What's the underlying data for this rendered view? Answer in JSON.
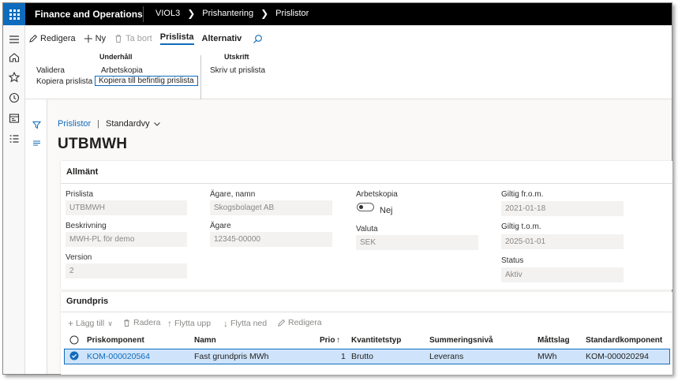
{
  "topbar": {
    "app_title": "Finance and Operations",
    "breadcrumbs": [
      "VIOL3",
      "Prishantering",
      "Prislistor"
    ]
  },
  "actionpane": {
    "edit_label": "Redigera",
    "new_label": "Ny",
    "delete_label": "Ta bort",
    "tab_active": "Prislista",
    "tab_other": "Alternativ",
    "groups": {
      "maintenance_title": "Underhåll",
      "validate": "Validera",
      "copy_pricelist": "Kopiera prislista",
      "work_copy": "Arbetskopia",
      "copy_to_existing": "Kopiera till befintlig prislista",
      "print_title": "Utskrift",
      "print_pricelist": "Skriv ut prislista"
    }
  },
  "page": {
    "breadcrumb_link": "Prislistor",
    "view_name": "Standardvy",
    "title": "UTBMWH"
  },
  "general": {
    "header": "Allmänt",
    "fields": {
      "prislista_label": "Prislista",
      "prislista_value": "UTBMWH",
      "beskrivning_label": "Beskrivning",
      "beskrivning_value": "MWH-PL för demo",
      "version_label": "Version",
      "version_value": "2",
      "agare_namn_label": "Ägare, namn",
      "agare_namn_value": "Skogsbolaget AB",
      "agare_label": "Ägare",
      "agare_value": "12345-00000",
      "arbetskopia_label": "Arbetskopia",
      "arbetskopia_value": "Nej",
      "valuta_label": "Valuta",
      "valuta_value": "SEK",
      "giltig_from_label": "Giltig fr.o.m.",
      "giltig_from_value": "2021-01-18",
      "giltig_tom_label": "Giltig t.o.m.",
      "giltig_tom_value": "2025-01-01",
      "status_label": "Status",
      "status_value": "Aktiv"
    }
  },
  "grid": {
    "header": "Grundpris",
    "toolbar": {
      "add": "Lägg till",
      "delete": "Radera",
      "move_up": "Flytta upp",
      "move_down": "Flytta ned",
      "edit": "Redigera"
    },
    "columns": {
      "prisk": "Priskomponent",
      "namn": "Namn",
      "prio": "Prio",
      "kvant": "Kvantitetstyp",
      "summ": "Summeringsnivå",
      "matt": "Måttslag",
      "std": "Standardkomponent"
    },
    "rows": [
      {
        "prisk": "KOM-000020564",
        "namn": "Fast grundpris MWh",
        "prio": "1",
        "kvant": "Brutto",
        "summ": "Leverans",
        "matt": "MWh",
        "std": "KOM-000020294"
      }
    ]
  },
  "colors": {
    "accent": "#0f6cbd",
    "topbar": "#000000",
    "selected_row": "#cfe4fa"
  }
}
